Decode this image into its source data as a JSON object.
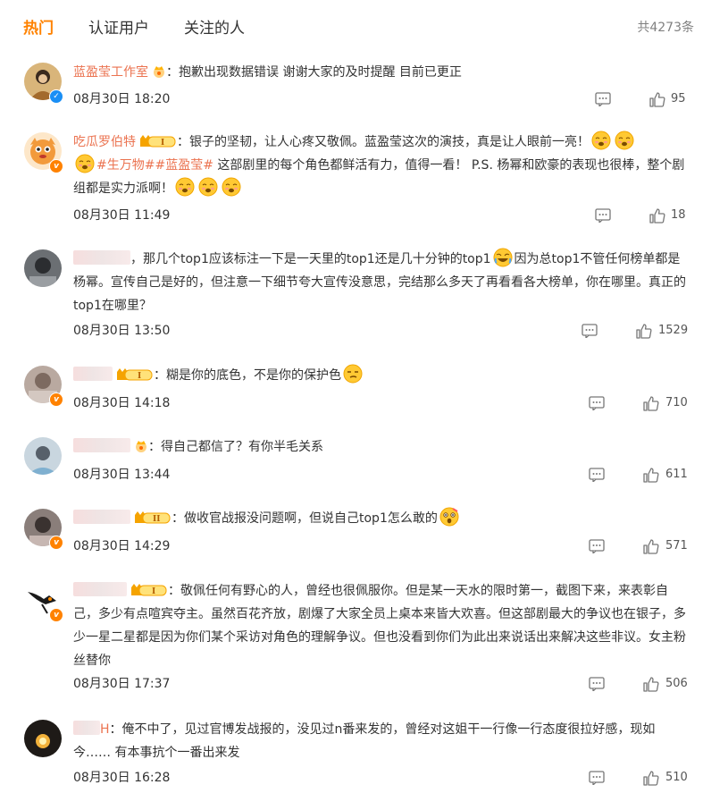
{
  "tabs": [
    {
      "label": "热门",
      "active": true
    },
    {
      "label": "认证用户",
      "active": false
    },
    {
      "label": "关注的人",
      "active": false
    }
  ],
  "total_label": "共4273条",
  "comments": [
    {
      "name": "蓝盈莹工作室",
      "sep": "：",
      "text": "抱歉出现数据错误 谢谢大家的及时提醒 目前已更正",
      "time": "08月30日 18:20",
      "likes": "95"
    },
    {
      "name": "吃瓜罗伯特",
      "sep": "：",
      "text1": "银子的坚韧，让人心疼又敬佩。蓝盈莹这次的演技，真是让人眼前一亮！",
      "topic1": "#生万物#",
      "topic2": "#蓝盈莹#",
      "text2": "这部剧里的每个角色都鲜活有力，值得一看！ P.S. 杨幂和欧豪的表现也很棒，整个剧组都是实力派啊！",
      "time": "08月30日 11:49",
      "likes": "18"
    },
    {
      "sep": "，",
      "text1": "那几个top1应该标注一下是一天里的top1还是几十分钟的top1",
      "text2": "因为总top1不管任何榜单都是杨幂。宣传自己是好的，但注意一下细节夸大宣传没意思，完结那么多天了再看看各大榜单，你在哪里。真正的top1在哪里？",
      "time": "08月30日 13:50",
      "likes": "1529"
    },
    {
      "sep": "：",
      "text": "糊是你的底色，不是你的保护色",
      "time": "08月30日 14:18",
      "likes": "710"
    },
    {
      "sep": "：",
      "text": "得自己都信了？有你半毛关系",
      "time": "08月30日 13:44",
      "likes": "611"
    },
    {
      "sep": "：",
      "text": "做收官战报没问题啊，但说自己top1怎么敢的",
      "time": "08月30日 14:29",
      "likes": "571"
    },
    {
      "sep": "：",
      "text": "敬佩任何有野心的人，曾经也很佩服你。但是某一天水的限时第一，截图下来，来表彰自己，多少有点喧宾夺主。虽然百花齐放，剧爆了大家全员上桌本来皆大欢喜。但这部剧最大的争议也在银子，多少一星二星都是因为你们某个采访对角色的理解争议。但也没看到你们为此出来说话出来解决这些非议。女主粉丝替你",
      "time": "08月30日 17:37",
      "likes": "506"
    },
    {
      "name_frag": "H",
      "sep": "：",
      "text": "俺不中了，见过官博发战报的，没见过n番来发的，曾经对这姐干一行像一行态度很拉好感，现如今…… 有本事抗个一番出来发",
      "time": "08月30日 16:28",
      "likes": "510"
    }
  ],
  "colors": {
    "accent": "#ff8200",
    "name": "#eb7350",
    "verified_blue": "#1a8ff5"
  },
  "icons": [
    "reply-icon",
    "like-icon",
    "crown-icon",
    "level-badge-icon",
    "emoji-icon",
    "verified-icon"
  ]
}
